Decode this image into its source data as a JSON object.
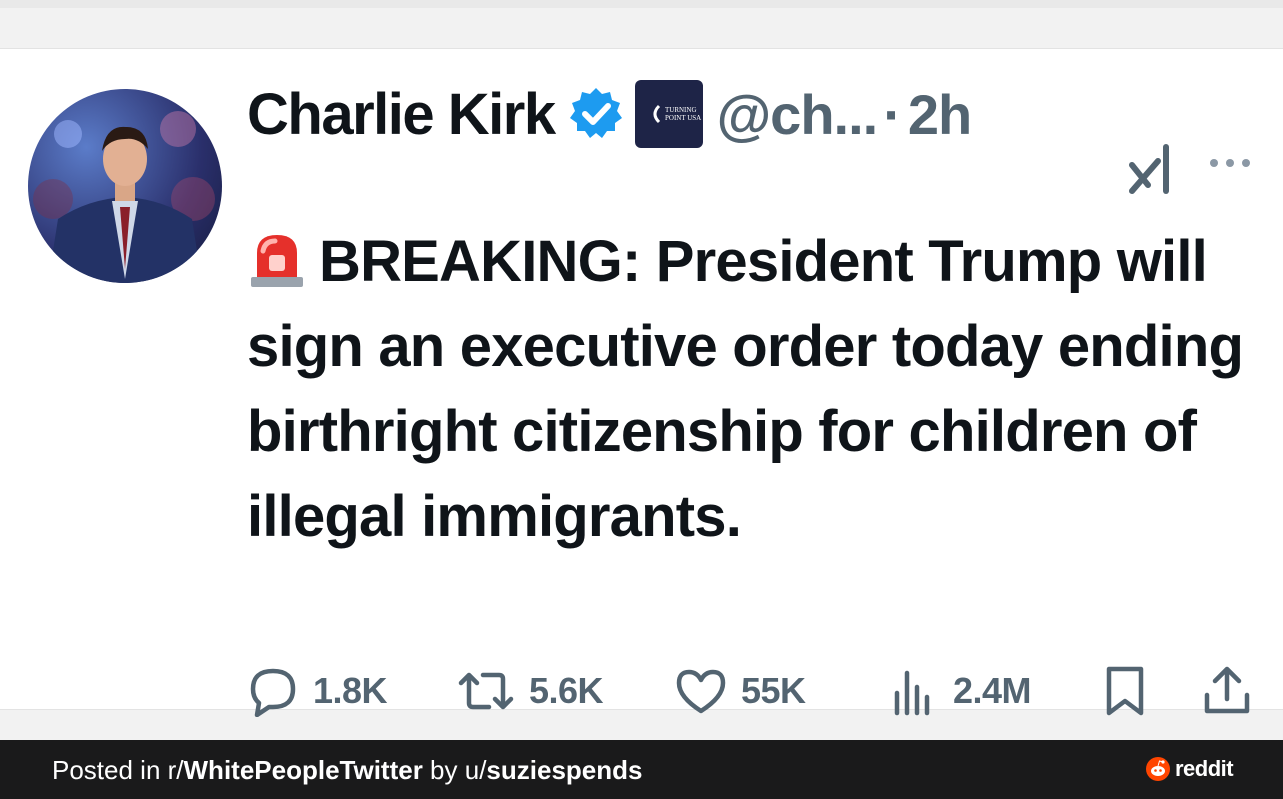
{
  "tweet": {
    "display_name": "Charlie Kirk",
    "handle": "@ch...",
    "separator": "·",
    "time": "2h",
    "org_badge_text": "TURNING POINT USA",
    "alert_icon": "police-light-emoji",
    "text": "BREAKING: President Trump will sign an executive order today ending birthright citizenship for children of illegal immigrants.",
    "stats": {
      "replies": "1.8K",
      "retweets": "5.6K",
      "likes": "55K",
      "views": "2.4M"
    }
  },
  "footer": {
    "prefix": "Posted in r/",
    "subreddit": "WhitePeopleTwitter",
    "by": " by u/",
    "user": "suziespends",
    "brand": "reddit"
  },
  "colors": {
    "text": "#0f1419",
    "secondary": "#536471",
    "verified": "#1d9bf0",
    "footer_bg": "#1a1a1b",
    "reddit_orange": "#ff4500"
  }
}
